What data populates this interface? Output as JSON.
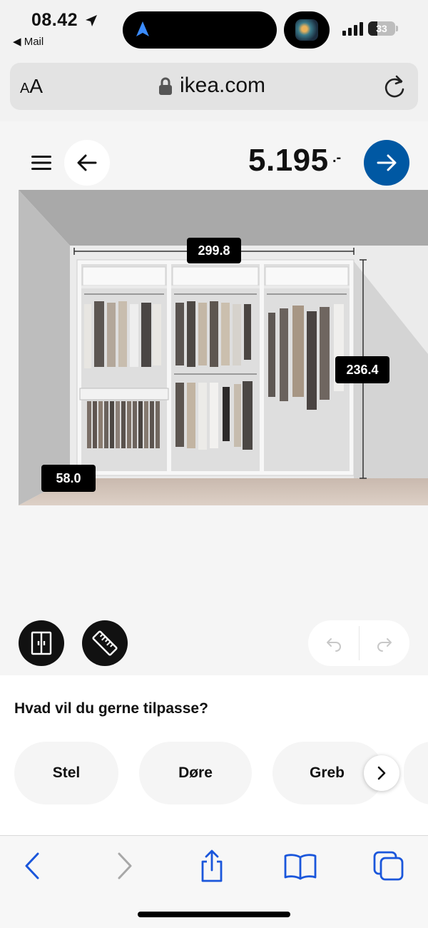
{
  "status_bar": {
    "time": "08.42",
    "back_app": "◀ Mail",
    "battery": "33",
    "location_icon": "location-arrow-icon",
    "signal_icon": "cellular-signal-icon"
  },
  "browser": {
    "text_size_label": "AA",
    "domain": "ikea.com",
    "lock_icon": "lock-icon",
    "reload_icon": "reload-icon"
  },
  "header": {
    "price": "5.195",
    "price_suffix": ".-",
    "menu_icon": "hamburger-menu-icon",
    "back_icon": "arrow-left-icon",
    "next_icon": "arrow-right-icon",
    "accent": "#0058a3"
  },
  "planner": {
    "width_label": "299.8",
    "height_label": "236.4",
    "depth_label": "58.0"
  },
  "controls": {
    "doors_icon": "wardrobe-doors-icon",
    "measure_icon": "ruler-icon",
    "undo_icon": "undo-icon",
    "redo_icon": "redo-icon"
  },
  "customize": {
    "question": "Hvad vil du gerne tilpasse?",
    "options": [
      "Stel",
      "Døre",
      "Greb"
    ],
    "next_icon": "chevron-right-icon"
  },
  "toolbar": {
    "items": [
      "back-icon",
      "forward-icon",
      "share-icon",
      "bookmarks-icon",
      "tabs-icon"
    ],
    "accent": "#1a56db"
  }
}
